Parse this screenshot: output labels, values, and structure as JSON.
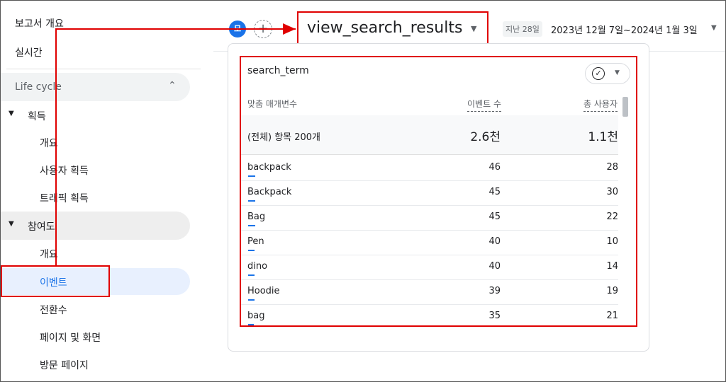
{
  "nav_top": {
    "report_overview": "보고서 개요",
    "realtime": "실시간"
  },
  "lifecycle": {
    "label": "Life cycle"
  },
  "acquisition": {
    "label": "획득",
    "items": [
      "개요",
      "사용자 획득",
      "트래픽 획득"
    ]
  },
  "engagement": {
    "label": "참여도",
    "items": [
      "개요",
      "이벤트",
      "전환수",
      "페이지 및 화면",
      "방문 페이지"
    ]
  },
  "header": {
    "avatar_letter": "모",
    "add_symbol": "+",
    "event_name": "view_search_results",
    "date_badge": "지난 28일",
    "date_range": "2023년 12월 7일~2024년 1월 3일"
  },
  "table": {
    "dimension_title": "search_term",
    "col_dimension": "맞춤 매개변수",
    "col_metric1": "이벤트 수",
    "col_metric2": "총 사용자",
    "total_label": "(전체) 항목 200개",
    "total_events": "2.6천",
    "total_users": "1.1천",
    "rows": [
      {
        "term": "backpack",
        "events": "46",
        "users": "28",
        "share": 1.0
      },
      {
        "term": "Backpack",
        "events": "45",
        "users": "30",
        "share": 0.98
      },
      {
        "term": "Bag",
        "events": "45",
        "users": "22",
        "share": 0.98
      },
      {
        "term": "Pen",
        "events": "40",
        "users": "10",
        "share": 0.87
      },
      {
        "term": "dino",
        "events": "40",
        "users": "14",
        "share": 0.87
      },
      {
        "term": "Hoodie",
        "events": "39",
        "users": "19",
        "share": 0.85
      },
      {
        "term": "bag",
        "events": "35",
        "users": "21",
        "share": 0.76
      }
    ]
  },
  "colors": {
    "accent": "#1a73e8",
    "highlight": "#e00000",
    "selected_bg": "#e8f0fe"
  },
  "icons": [
    "expand-less-icon",
    "caret-down-icon",
    "check-circle-icon",
    "add-circle-icon",
    "dropdown-icon"
  ]
}
